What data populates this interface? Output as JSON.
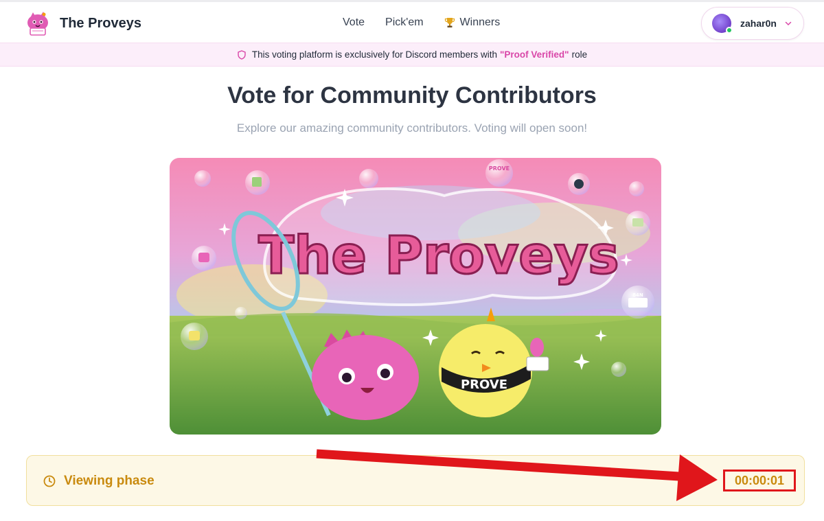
{
  "app": {
    "name": "The Proveys"
  },
  "nav": {
    "items": [
      {
        "label": "Vote"
      },
      {
        "label": "Pick'em"
      },
      {
        "label": "Winners"
      }
    ]
  },
  "user": {
    "name": "zahar0n",
    "status": "online"
  },
  "notice": {
    "prefix": "This voting platform is exclusively for Discord members with",
    "highlight": "\"Proof Verified\"",
    "suffix": "role"
  },
  "page": {
    "title": "Vote for Community Contributors",
    "subtitle": "Explore our amazing community contributors. Voting will open soon!"
  },
  "hero": {
    "artwork_lettering": "The Proveys",
    "band_text": "PROVE",
    "bubble_badge_text": "PROVE",
    "bubble_tag_text": "84N"
  },
  "phase": {
    "label": "Viewing phase",
    "countdown": "00:00:01"
  },
  "colors": {
    "accent": "#d946a8",
    "phase_text": "#c98a0e",
    "phase_bg": "#fdf8e6",
    "annotation": "#e0161b"
  }
}
